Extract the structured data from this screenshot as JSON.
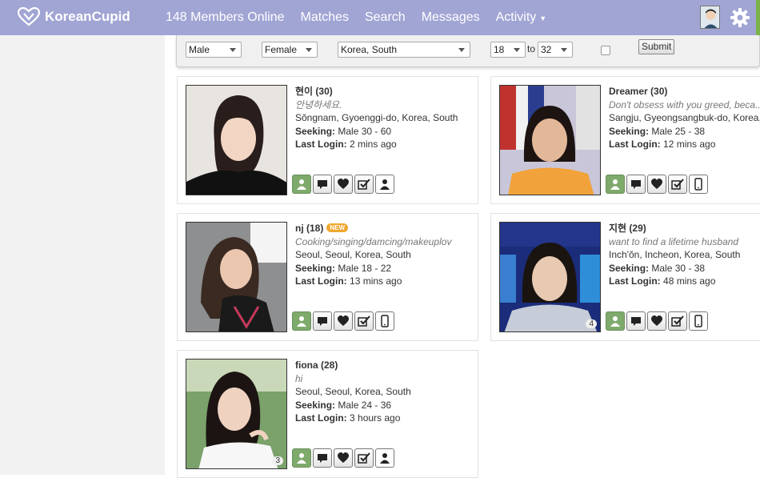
{
  "header": {
    "brand": "KoreanCupid",
    "nav": [
      "148 Members Online",
      "Matches",
      "Search",
      "Messages",
      "Activity"
    ]
  },
  "filters": {
    "gender_self": "Male",
    "gender_seeking": "Female",
    "country": "Korea, South",
    "age_min": "18",
    "age_to": "to",
    "age_max": "32",
    "submit": "Submit"
  },
  "profiles": [
    {
      "name": "현이 (30)",
      "tagline": "안녕하세요.",
      "location": "Sŏngnam, Gyoenggi-do, Korea, South",
      "seeking_label": "Seeking:",
      "seeking": "Male 30 - 60",
      "login_label": "Last Login:",
      "login": "2 mins ago",
      "photo_count": "",
      "new": ""
    },
    {
      "name": "Dreamer (30)",
      "tagline": "Don't obsess with you greed, beca...",
      "location": "Sangju, Gyeongsangbuk-do, Korea, South",
      "seeking_label": "Seeking:",
      "seeking": "Male 25 - 38",
      "login_label": "Last Login:",
      "login": "12 mins ago",
      "photo_count": "",
      "new": ""
    },
    {
      "name": "nj (18)",
      "tagline": "Cooking/singing/damcing/makeuplov",
      "location": "Seoul, Seoul, Korea, South",
      "seeking_label": "Seeking:",
      "seeking": "Male 18 - 22",
      "login_label": "Last Login:",
      "login": "13 mins ago",
      "photo_count": "",
      "new": "NEW"
    },
    {
      "name": "지현 (29)",
      "tagline": "want to find a lifetime husband",
      "location": "Inch'ŏn, Incheon, Korea, South",
      "seeking_label": "Seeking:",
      "seeking": "Male 30 - 38",
      "login_label": "Last Login:",
      "login": "48 mins ago",
      "photo_count": "4",
      "new": ""
    },
    {
      "name": "fiona (28)",
      "tagline": "hi",
      "location": "Seoul, Seoul, Korea, South",
      "seeking_label": "Seeking:",
      "seeking": "Male 24 - 36",
      "login_label": "Last Login:",
      "login": "3 hours ago",
      "photo_count": "3",
      "new": ""
    }
  ]
}
